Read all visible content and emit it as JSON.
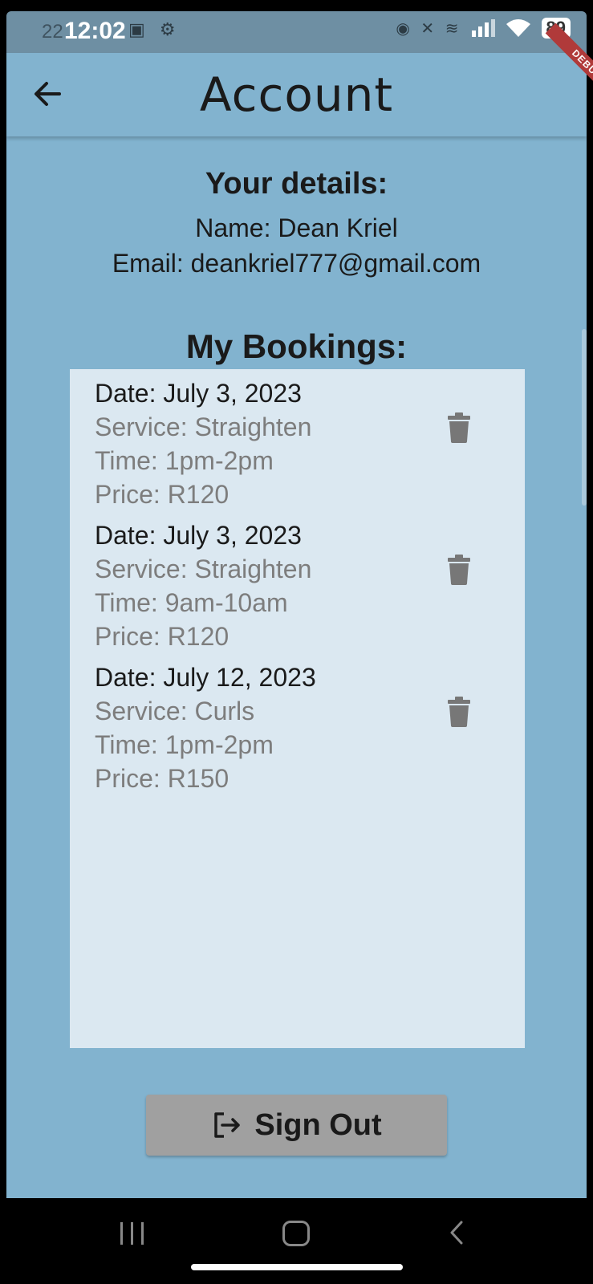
{
  "status_bar": {
    "ghost_text": "22",
    "time": "12:02",
    "battery": "89"
  },
  "app_bar": {
    "title": "Account",
    "debug_label": "DEBUG"
  },
  "details": {
    "heading": "Your details:",
    "name": "Name: Dean Kriel",
    "email": "Email: deankriel777@gmail.com"
  },
  "bookings": {
    "heading": "My Bookings:",
    "items": [
      {
        "date": "Date: July 3, 2023",
        "service": "Service: Straighten",
        "time": "Time: 1pm-2pm",
        "price": "Price: R120"
      },
      {
        "date": "Date: July 3, 2023",
        "service": "Service: Straighten",
        "time": "Time: 9am-10am",
        "price": "Price: R120"
      },
      {
        "date": "Date: July 12, 2023",
        "service": "Service: Curls",
        "time": "Time: 1pm-2pm",
        "price": "Price: R150"
      }
    ]
  },
  "sign_out": {
    "label": "Sign Out"
  },
  "colors": {
    "background": "#82b3cf",
    "panel": "#dbe8f1",
    "button": "#a0a0a0",
    "trash_icon": "#777777"
  },
  "icons": [
    "back-arrow-icon",
    "trash-icon",
    "sign-out-icon"
  ]
}
